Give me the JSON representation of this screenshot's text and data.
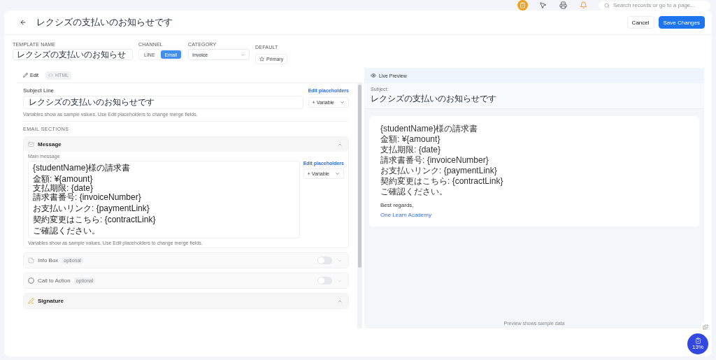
{
  "topbar": {
    "search": {
      "placeholder": "Search records or go to a page..."
    }
  },
  "header": {
    "title": "レクシズの支払いのお知らせです",
    "buttons": [
      {
        "label": "Cancel",
        "kind": "secondary"
      },
      {
        "label": "Save Changes",
        "kind": "primary"
      }
    ]
  },
  "fields": {
    "template_name": {
      "label": "TEMPLATE NAME",
      "value": "レクシズの支払いのお知らせ"
    },
    "channel": {
      "label": "CHANNEL",
      "options": [
        {
          "label": "LINE",
          "selected": false
        },
        {
          "label": "Email",
          "selected": true
        }
      ]
    },
    "category": {
      "label": "CATEGORY",
      "value": "Invoice"
    },
    "default": {
      "label": "DEFAULT",
      "button": "Primary"
    }
  },
  "editor_tabs": [
    {
      "label": "Edit",
      "kind": "edit",
      "selected": true
    },
    {
      "label": "HTML",
      "kind": "html",
      "selected": false
    }
  ],
  "subject": {
    "label": "Subject Line",
    "link": "Edit placeholders",
    "value": "レクシズの支払いのお知らせです",
    "variable_button": "+ Variable",
    "hint": "Variables show as sample values. Use Edit placeholders to change merge fields."
  },
  "sections_label": "EMAIL SECTIONS",
  "sections": [
    {
      "kind": "message",
      "title": "Message",
      "expanded": true,
      "field_label": "Main message",
      "link": "Edit placeholders",
      "variable_button": "+ Variable",
      "paragraphs": [
        {
          "lines": [
            "{studentName}様の請求書"
          ]
        },
        {
          "lines": [
            "金額: ¥{amount}",
            "支払期限: {date}",
            "請求書番号: {invoiceNumber}"
          ]
        },
        {
          "lines": [
            "お支払いリンク: {paymentLink}"
          ]
        },
        {
          "lines": [
            "契約変更はこちら: {contractLink}"
          ]
        },
        {
          "lines": [
            "ご確認ください。"
          ]
        }
      ],
      "hint": "Variables show as sample values. Use Edit placeholders to change merge fields."
    },
    {
      "kind": "info",
      "title": "Info Box",
      "badge": "optional",
      "on": false,
      "expanded": false
    },
    {
      "kind": "cta",
      "title": "Call to Action",
      "badge": "optional",
      "on": false,
      "expanded": false
    },
    {
      "kind": "signature",
      "title": "Signature",
      "expanded": true
    }
  ],
  "preview": {
    "title": "Live Preview",
    "subject_label": "Subject:",
    "subject": "レクシズの支払いのお知らせです",
    "lines": [
      "{studentName}様の請求書",
      "金額: ¥{amount}",
      "支払期限: {date}",
      "請求書番号: {invoiceNumber}",
      "お支払いリンク: {paymentLink}",
      "契約変更はこちら: {contractLink}",
      "ご確認ください。"
    ],
    "closing": "Best regards,",
    "sender": "One Learn Academy",
    "footer": "Preview shows sample data"
  },
  "progress_badge": "13%"
}
